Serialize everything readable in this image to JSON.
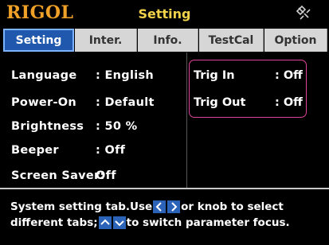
{
  "header": {
    "brand": "RIGOL",
    "title": "Setting",
    "status_icon": "satellite-icon"
  },
  "tabs": [
    {
      "label": "Setting",
      "active": true
    },
    {
      "label": "Inter.",
      "active": false
    },
    {
      "label": "Info.",
      "active": false
    },
    {
      "label": "TestCal",
      "active": false
    },
    {
      "label": "Option",
      "active": false
    }
  ],
  "settings": {
    "language": {
      "label": "Language",
      "value": ": English"
    },
    "power_on": {
      "label": "Power-On",
      "value": ": Default"
    },
    "brightness": {
      "label": "Brightness",
      "value": ": 50 %"
    },
    "beeper": {
      "label": "Beeper",
      "value": ": Off"
    },
    "screen_saver": {
      "label": "Screen Saver:",
      "value": "Off"
    }
  },
  "trigger": {
    "trig_in": {
      "label": "Trig In",
      "value": ": Off"
    },
    "trig_out": {
      "label": "Trig Out",
      "value": ": Off"
    }
  },
  "help": {
    "line1_pre": "System setting tab.Use",
    "line1_left_key": "<",
    "line1_right_key": ">",
    "line1_post": "or knob to select",
    "line2_pre": "different tabs;",
    "line2_up_key": "^",
    "line2_down_key": "v",
    "line2_post": "to switch parameter focus."
  },
  "colors": {
    "brand": "#f0a128",
    "title": "#f0d24a",
    "active_tab": "#1f58ad",
    "inactive_tab": "#d6d6d6",
    "highlight_border": "#e0439a"
  }
}
